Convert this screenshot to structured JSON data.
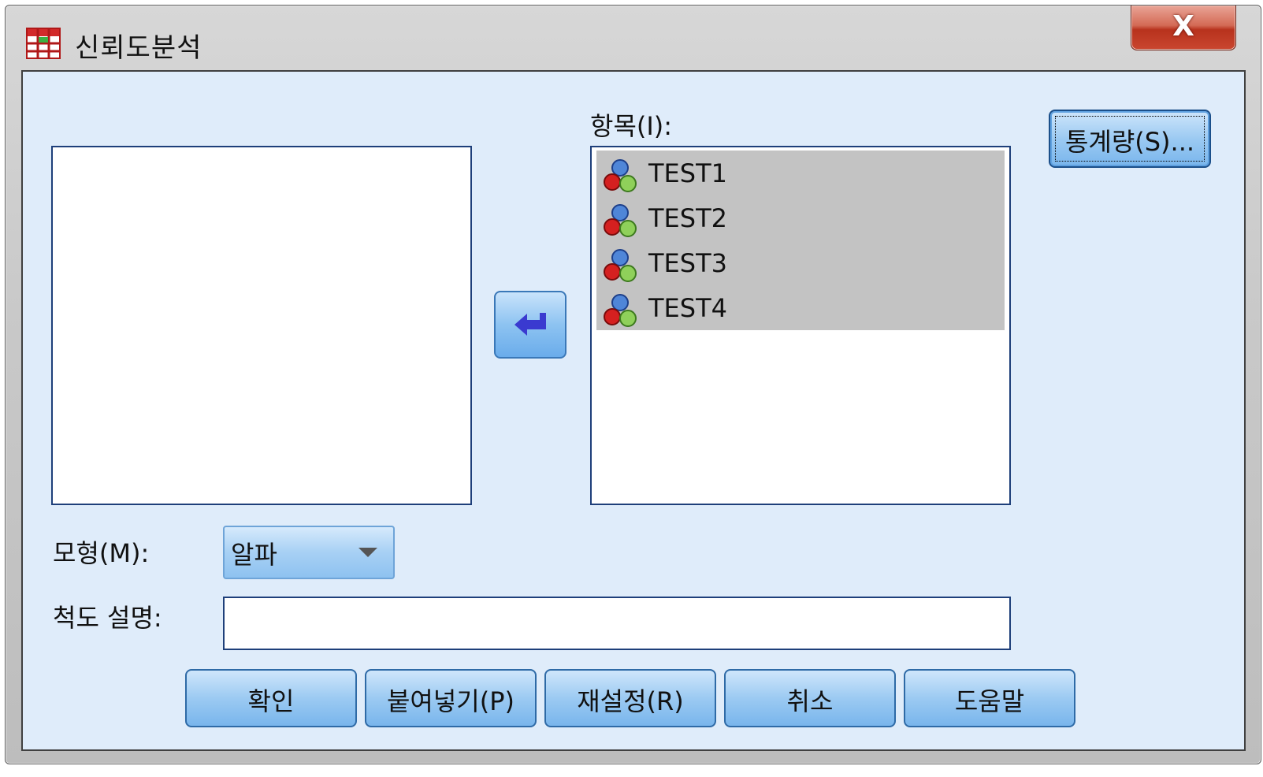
{
  "window": {
    "title": "신뢰도분석",
    "close_label": "X"
  },
  "items_label": "항목(I):",
  "items": [
    {
      "label": "TEST1",
      "icon": "scale-variable-icon"
    },
    {
      "label": "TEST2",
      "icon": "scale-variable-icon"
    },
    {
      "label": "TEST3",
      "icon": "scale-variable-icon"
    },
    {
      "label": "TEST4",
      "icon": "scale-variable-icon"
    }
  ],
  "statistics_button": "통계량(S)...",
  "model": {
    "label": "모형(M):",
    "value": "알파"
  },
  "scale_label": {
    "label": "척도 설명:",
    "value": ""
  },
  "buttons": {
    "ok": "확인",
    "paste": "붙여넣기(P)",
    "reset": "재설정(R)",
    "cancel": "취소",
    "help": "도움말"
  },
  "colors": {
    "client_bg": "#dfecfa",
    "selected_item_bg": "#c3c3c3",
    "button_blue": "#9ccaf2",
    "close_red": "#c9462f"
  }
}
